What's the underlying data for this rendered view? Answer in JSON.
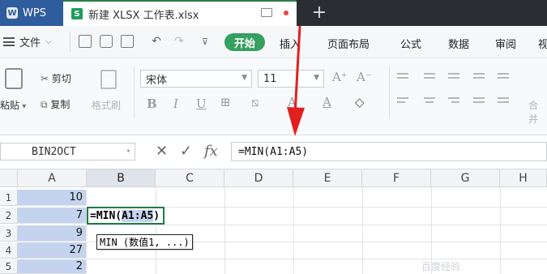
{
  "tabs": {
    "app": "WPS",
    "file": "新建 XLSX 工作表.xlsx",
    "add": "+"
  },
  "menu": {
    "file": "文件",
    "start": "开始",
    "items": [
      "插入",
      "页面布局",
      "公式",
      "数据",
      "审阅",
      "视"
    ]
  },
  "ribbon": {
    "paste": "粘贴",
    "cut": "剪切",
    "copy": "复制",
    "format_painter": "格式刷",
    "font_name": "宋体",
    "font_size": "11",
    "merge": "合并"
  },
  "formula_bar": {
    "name_box": "BIN2OCT",
    "fx": "fx",
    "formula": "=MIN(A1:A5)"
  },
  "grid": {
    "columns": [
      "A",
      "B",
      "C",
      "D",
      "E",
      "F",
      "G",
      "H"
    ],
    "rows": [
      "1",
      "2",
      "3",
      "4",
      "5"
    ],
    "column_a_values": [
      "10",
      "7",
      "9",
      "27",
      "2"
    ],
    "b2_prefix": "=MIN(",
    "b2_ref_start": "A1:",
    "b2_ref_end": "A5",
    "b2_suffix": ")",
    "tooltip": "MIN (数值1, ...)"
  },
  "watermark": "百度经验",
  "colors": {
    "accent_green": "#36a060",
    "selection": "#c5d4ee",
    "arrow": "#e02020"
  }
}
